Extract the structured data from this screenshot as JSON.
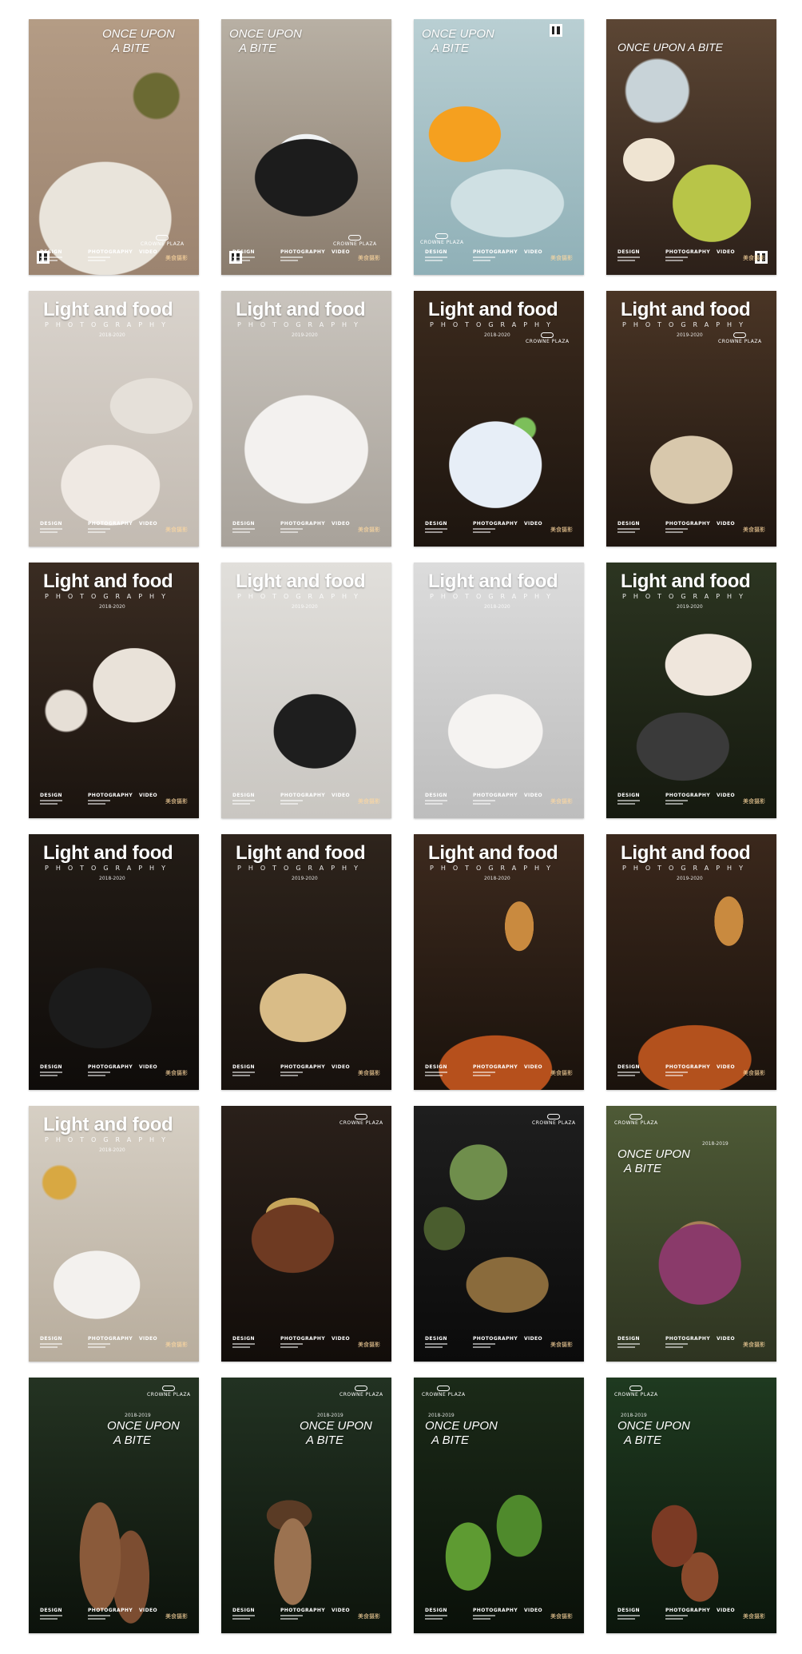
{
  "poster_texts": {
    "light_title": "Light and food",
    "photography": "PHOTOGRAPHY",
    "once_line1": "ONCE UPON",
    "once_line2": "A BITE",
    "once_one_line": "ONCE UPON A BITE",
    "brand": "CROWNE PLAZA",
    "design": "DESIGN",
    "photo_label": "PHOTOGRAPHY",
    "video": "VIDEO",
    "years_a": "2018-2020",
    "years_b": "2019-2020",
    "years_c": "2018-2019",
    "signature": "美食摄影"
  },
  "colors": {
    "light_bg": "#d8d2c8",
    "dark_bg": "#2a211a",
    "brand_accent": "#ffffff"
  },
  "posters": [
    {
      "style": "once-warm",
      "photo": "dumplings platter with chili oil dish"
    },
    {
      "style": "once-warm",
      "photo": "bird nest dessert in dark bowl"
    },
    {
      "style": "once-cool",
      "photo": "jelly cubes on glass plate"
    },
    {
      "style": "once-dark",
      "photo": "soup pot with ladle and eggs"
    },
    {
      "style": "light-light",
      "photo": "braised fish with soup"
    },
    {
      "style": "light-light",
      "photo": "vegetable stew with spoon"
    },
    {
      "style": "light-dark",
      "photo": "crab dish on patterned plate"
    },
    {
      "style": "light-dark",
      "photo": "wooden basket with broth"
    },
    {
      "style": "light-dark",
      "photo": "hot pot with sauce dishes"
    },
    {
      "style": "light-light",
      "photo": "clay pot with squid"
    },
    {
      "style": "light-light",
      "photo": "shrimp on white flower plate"
    },
    {
      "style": "light-dark",
      "photo": "congee bowl with prawns"
    },
    {
      "style": "light-dark",
      "photo": "stir fry shrimp wok"
    },
    {
      "style": "light-dark",
      "photo": "chicken soup in enamel pot"
    },
    {
      "style": "light-dark",
      "photo": "roast duck with chopsticks"
    },
    {
      "style": "light-dark",
      "photo": "roast duck slice"
    },
    {
      "style": "light-light",
      "photo": "rice bowl with potatoes"
    },
    {
      "style": "dark-brand",
      "photo": "copper pot with rice"
    },
    {
      "style": "dark-brand",
      "photo": "pumpkin and mushrooms"
    },
    {
      "style": "once-forest",
      "photo": "basket of mushrooms on woven cloth"
    },
    {
      "style": "once-forest",
      "photo": "wild mushrooms cluster"
    },
    {
      "style": "once-forest",
      "photo": "porcini mushrooms on moss"
    },
    {
      "style": "once-forest",
      "photo": "green peppers and leaves"
    },
    {
      "style": "once-forest",
      "photo": "red mushrooms in forest"
    }
  ]
}
